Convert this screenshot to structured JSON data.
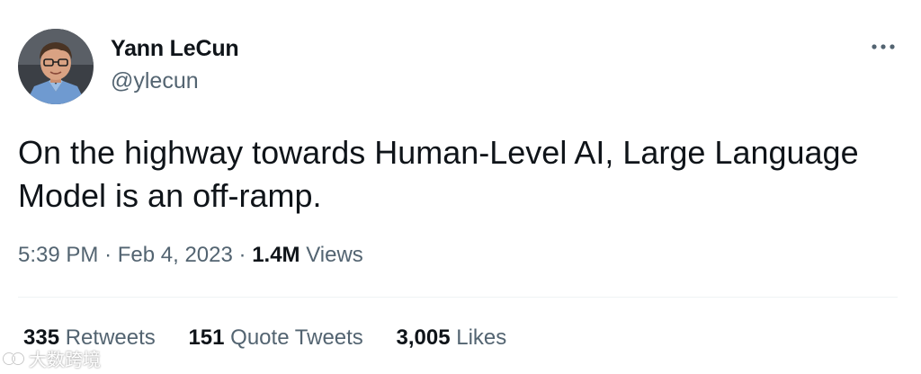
{
  "author": {
    "name": "Yann LeCun",
    "handle": "@ylecun",
    "avatar": "profile-photo"
  },
  "menu_icon": "more-horizontal-icon",
  "tweet": {
    "text": "On the highway towards Human-Level AI, Large Language Model is an off-ramp.",
    "time": "5:39 PM",
    "separator": "·",
    "date": "Feb 4, 2023",
    "views_count": "1.4M",
    "views_label": "Views"
  },
  "stats": {
    "retweets": {
      "count": "335",
      "label": "Retweets"
    },
    "quote_tweets": {
      "count": "151",
      "label": "Quote Tweets"
    },
    "likes": {
      "count": "3,005",
      "label": "Likes"
    }
  },
  "watermark": {
    "text": "大数跨境",
    "icon": "watermark-logo-icon"
  },
  "colors": {
    "primary_text": "#0f1419",
    "secondary_text": "#536471",
    "divider": "#eff3f4",
    "background": "#ffffff"
  }
}
